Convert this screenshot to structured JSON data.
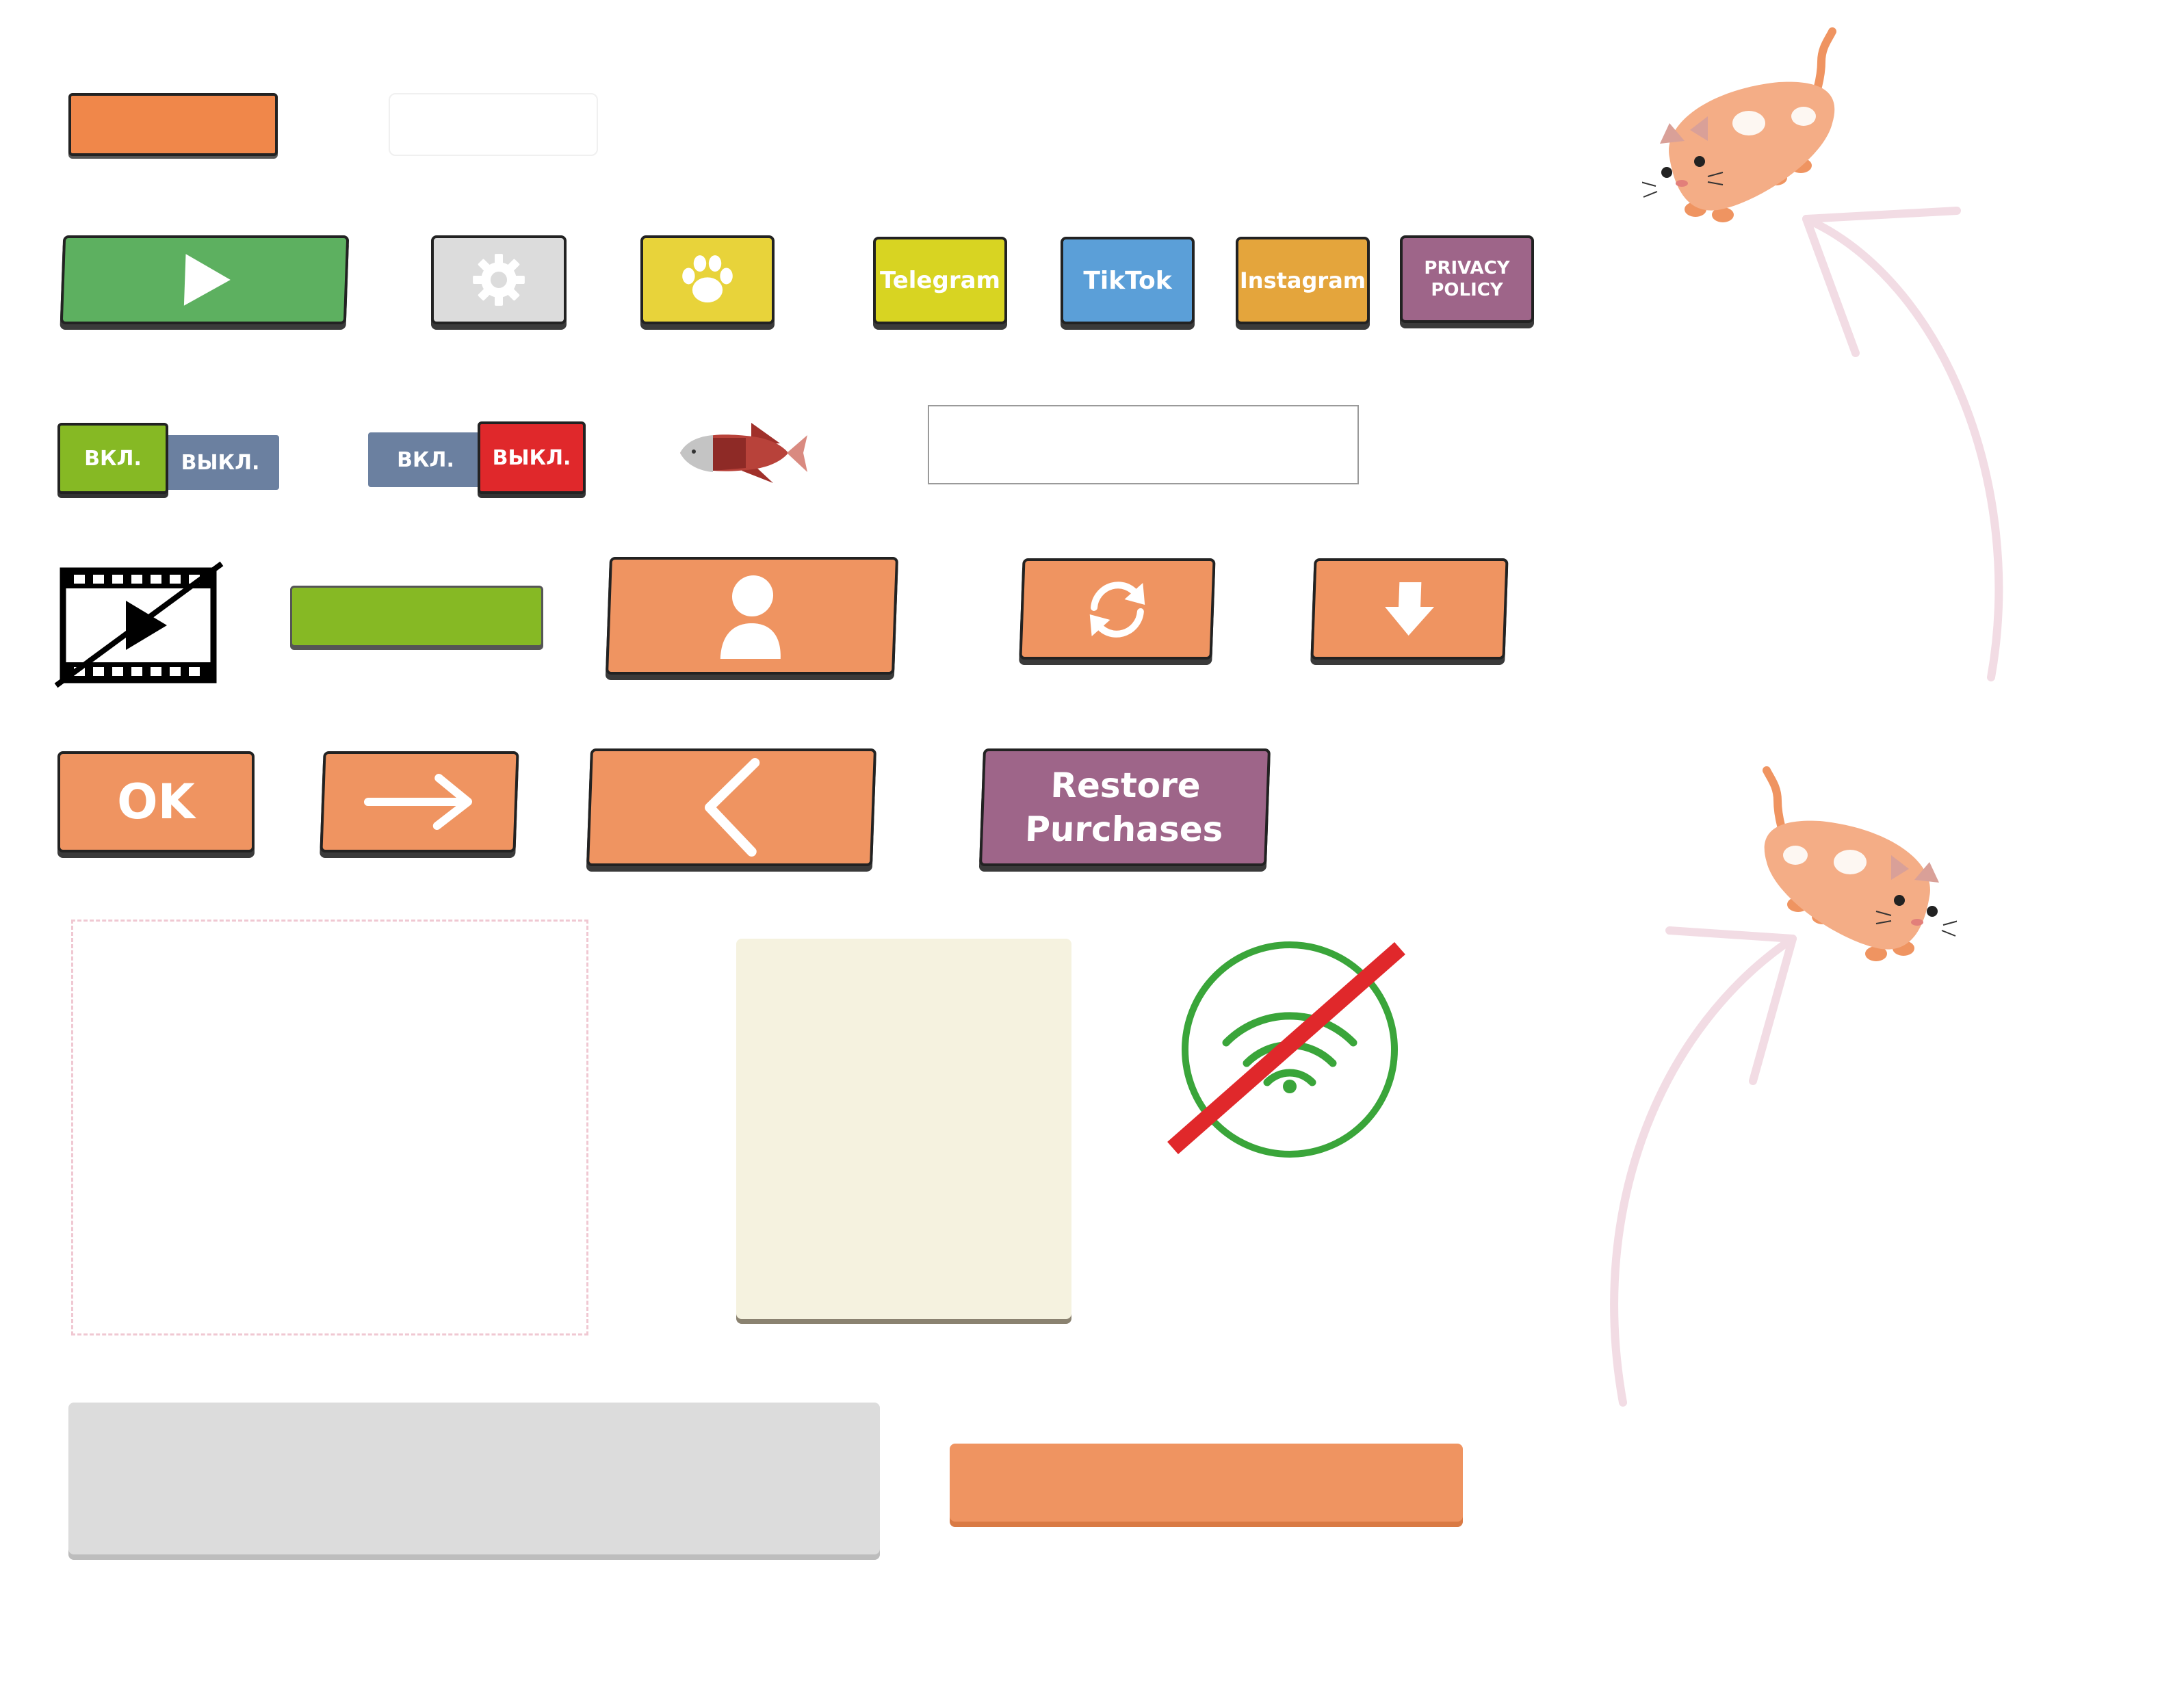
{
  "colors": {
    "orange": "#ef9461",
    "green": "#5db060",
    "gray": "#dcdcdc",
    "yellow": "#e8d33a",
    "telegram_yellow": "#d8d422",
    "tiktok_blue": "#5b9fd8",
    "instagram_orange": "#e4a53c",
    "purple": "#9e6589",
    "lime": "#86b924",
    "slate": "#6b80a0",
    "red": "#e0282b",
    "cream": "#f5f2df",
    "wifi_green": "#3aa53a"
  },
  "social": {
    "telegram": "Telegram",
    "tiktok": "TikTok",
    "instagram": "Instagram",
    "privacy_line1": "PRIVACY",
    "privacy_line2": "POLICY"
  },
  "toggles": {
    "on": "ВКЛ.",
    "off": "ВЫКЛ."
  },
  "buttons": {
    "ok": "OK",
    "restore_line1": "Restore",
    "restore_line2": "Purchases"
  },
  "icons": {
    "play": "play-icon",
    "settings": "gear-icon",
    "paw": "paw-icon",
    "user": "user-icon",
    "refresh": "refresh-icon",
    "download": "download-arrow-icon",
    "arrow_right": "arrow-right-icon",
    "back": "chevron-left-icon",
    "no_video": "video-off-icon",
    "no_wifi": "wifi-off-icon",
    "fish": "fish-icon",
    "cat": "cat-icon"
  }
}
